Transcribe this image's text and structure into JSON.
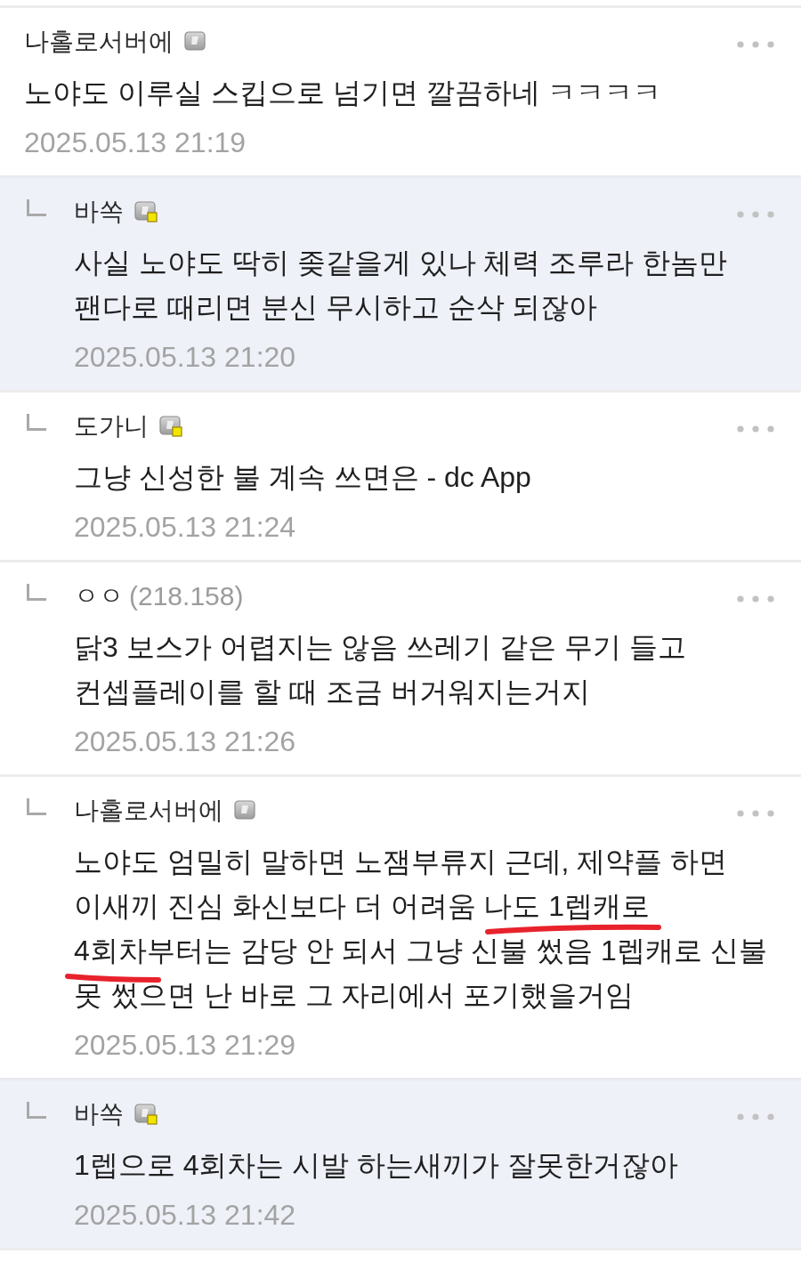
{
  "comments": [
    {
      "nickname": "나홀로서버에",
      "badge": {
        "kind": "fixed"
      },
      "body": "노야도 이루실 스킵으로 넘기면 깔끔하네 ㅋㅋㅋㅋ",
      "date": "2025.05.13 21:19",
      "highlighted": false,
      "marked": false,
      "children": [
        {
          "nickname": "바쏙",
          "badge": {
            "kind": "semi_fixed"
          },
          "body": "사실 노야도 딱히 좆같을게 있나 체력 조루라 한놈만 팬다로 때리면 분신 무시하고 순삭 되잖아",
          "date": "2025.05.13 21:20",
          "highlighted": true,
          "marked": false
        },
        {
          "nickname": "도가니",
          "badge": {
            "kind": "semi_fixed"
          },
          "body": "그냥 신성한 불 계속 쓰면은 - dc App",
          "date": "2025.05.13 21:24",
          "highlighted": false,
          "marked": false
        },
        {
          "nickname": "ㅇㅇ",
          "ip": "(218.158)",
          "body": "닭3 보스가 어렵지는 않음 쓰레기 같은 무기 들고 컨셉플레이를 할 때 조금 버거워지는거지",
          "date": "2025.05.13 21:26",
          "highlighted": false,
          "marked": false
        },
        {
          "nickname": "나홀로서버에",
          "badge": {
            "kind": "fixed"
          },
          "body": "노야도 엄밀히 말하면 노잼부류지 근데, 제약플 하면 이새끼 진심 화신보다 더 어려움 나도 1렙캐로 4회차부터는 감당 안 되서 그냥 신불 썼음 1렙캐로 신불 못 썼으면 난 바로 그 자리에서 포기했을거임",
          "date": "2025.05.13 21:29",
          "highlighted": false,
          "marked": true
        },
        {
          "nickname": "바쏙",
          "badge": {
            "kind": "semi_fixed"
          },
          "body": "1렙으로 4회차는 시발 하는새끼가 잘못한거잖아",
          "date": "2025.05.13 21:42",
          "highlighted": true,
          "marked": false
        }
      ]
    }
  ]
}
